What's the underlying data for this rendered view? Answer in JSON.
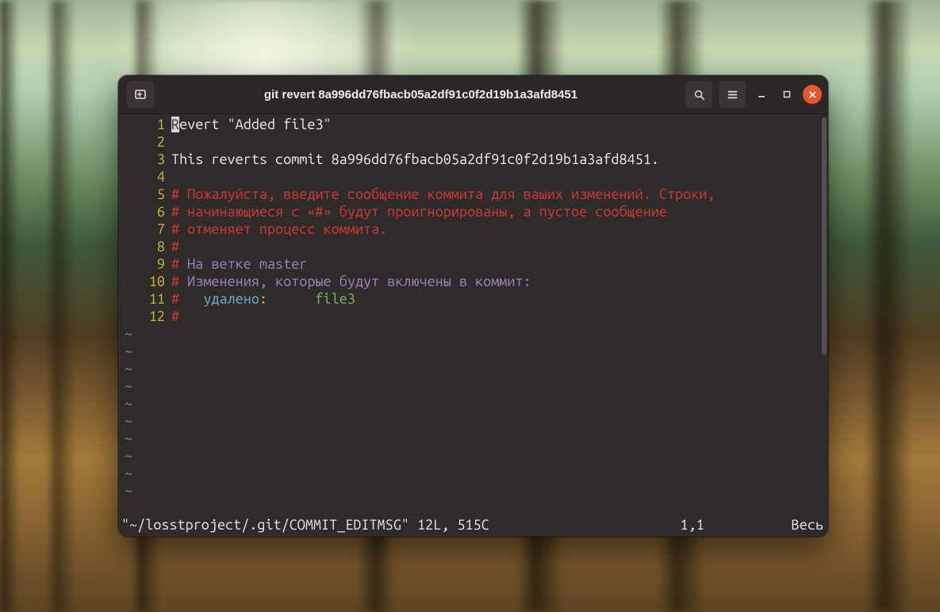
{
  "window": {
    "title": "git revert 8a996dd76fbacb05a2df91c0f2d19b1a3afd8451"
  },
  "editor": {
    "lines": {
      "l1": {
        "num": "1",
        "cursor_char": "R",
        "rest": "evert \"Added file3\""
      },
      "l2": {
        "num": "2",
        "text": ""
      },
      "l3": {
        "num": "3",
        "text": "This reverts commit 8a996dd76fbacb05a2df91c0f2d19b1a3afd8451."
      },
      "l4": {
        "num": "4",
        "text": ""
      },
      "l5": {
        "num": "5",
        "text": "# Пожалуйста, введите сообщение коммита для ваших изменений. Строки,"
      },
      "l6": {
        "num": "6",
        "text": "# начинающиеся с «#» будут проигнорированы, а пустое сообщение"
      },
      "l7": {
        "num": "7",
        "text": "# отменяет процесс коммита."
      },
      "l8": {
        "num": "8",
        "text": "#"
      },
      "l9": {
        "num": "9",
        "hash": "# ",
        "rest": "На ветке master"
      },
      "l10": {
        "num": "10",
        "hash": "# ",
        "rest": "Изменения, которые будут включены в коммит:"
      },
      "l11": {
        "num": "11",
        "hash": "#",
        "label": "   удалено",
        "colon": ":      ",
        "file": "file3"
      },
      "l12": {
        "num": "12",
        "text": "#"
      }
    },
    "tilde": "~"
  },
  "status": {
    "left": "\"~/losstproject/.git/COMMIT_EDITMSG\" 12L, 515C",
    "pos": "1,1",
    "right": "Весь"
  }
}
